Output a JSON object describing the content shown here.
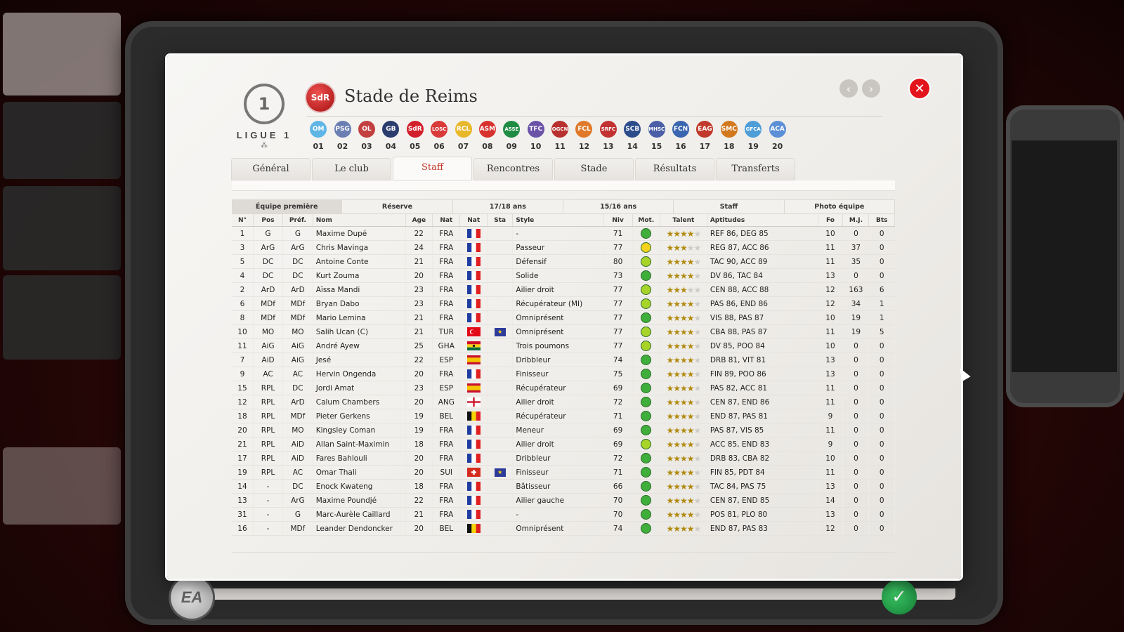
{
  "window": {
    "club_name": "Stade de Reims",
    "club_badge_text": "SdR"
  },
  "league": {
    "name": "LIGUE 1",
    "sub": "⁂"
  },
  "nav": {
    "prev": "‹",
    "next": "›",
    "close": "✕"
  },
  "clubs": [
    {
      "num": "01",
      "color": "#5fb6e6",
      "text": "OM"
    },
    {
      "num": "02",
      "color": "#6c7fb2",
      "text": "PSG"
    },
    {
      "num": "03",
      "color": "#c24040",
      "text": "OL"
    },
    {
      "num": "04",
      "color": "#2b3c6e",
      "text": "GB"
    },
    {
      "num": "05",
      "color": "#d21f2b",
      "text": "SdR"
    },
    {
      "num": "06",
      "color": "#d93a3a",
      "text": "LOSC"
    },
    {
      "num": "07",
      "color": "#e8b82a",
      "text": "RCL"
    },
    {
      "num": "08",
      "color": "#d8322f",
      "text": "ASM"
    },
    {
      "num": "09",
      "color": "#1f8c44",
      "text": "ASSE"
    },
    {
      "num": "10",
      "color": "#6b54a8",
      "text": "TFC"
    },
    {
      "num": "11",
      "color": "#b83030",
      "text": "OGCN"
    },
    {
      "num": "12",
      "color": "#e07a2a",
      "text": "FCL"
    },
    {
      "num": "13",
      "color": "#c23232",
      "text": "SRFC"
    },
    {
      "num": "14",
      "color": "#2c4c8c",
      "text": "SCB"
    },
    {
      "num": "15",
      "color": "#4b5fa8",
      "text": "MHSC"
    },
    {
      "num": "16",
      "color": "#3a66b0",
      "text": "FCN"
    },
    {
      "num": "17",
      "color": "#c0392b",
      "text": "EAG"
    },
    {
      "num": "18",
      "color": "#d2781e",
      "text": "SMC"
    },
    {
      "num": "19",
      "color": "#4f9ed8",
      "text": "GFCA"
    },
    {
      "num": "20",
      "color": "#5c8fd6",
      "text": "ACA"
    }
  ],
  "tabs": [
    {
      "label": "Général"
    },
    {
      "label": "Le club"
    },
    {
      "label": "Staff"
    },
    {
      "label": "Rencontres"
    },
    {
      "label": "Stade"
    },
    {
      "label": "Résultats"
    },
    {
      "label": "Transferts"
    }
  ],
  "active_tab": "Staff",
  "subtabs": [
    {
      "label": "Équipe première"
    },
    {
      "label": "Réserve"
    },
    {
      "label": "17/18 ans"
    },
    {
      "label": "15/16 ans"
    },
    {
      "label": "Staff"
    },
    {
      "label": "Photo équipe"
    }
  ],
  "columns": [
    "N°",
    "Pos",
    "Préf.",
    "Nom",
    "Age",
    "Nat",
    "Nat",
    "Sta",
    "Style",
    "Niv",
    "Mot.",
    "Talent",
    "Aptitudes",
    "Fo",
    "M.J.",
    "Bts"
  ],
  "players": [
    {
      "n": "1",
      "pos": "G",
      "pref": "G",
      "nom": "Maxime Dupé",
      "age": "22",
      "nat": "FRA",
      "flag": "fr",
      "sta": "",
      "style": "-",
      "niv": "71",
      "mot": "green",
      "talent": 4,
      "apt": "REF 86, DEG 85",
      "fo": "10",
      "mj": "0",
      "bts": "0"
    },
    {
      "n": "3",
      "pos": "ArG",
      "pref": "ArG",
      "nom": "Chris Mavinga",
      "age": "24",
      "nat": "FRA",
      "flag": "fr",
      "sta": "",
      "style": "Passeur",
      "niv": "77",
      "mot": "yellow",
      "talent": 3,
      "apt": "REG 87, ACC 86",
      "fo": "11",
      "mj": "37",
      "bts": "0"
    },
    {
      "n": "5",
      "pos": "DC",
      "pref": "DC",
      "nom": "Antoine Conte",
      "age": "21",
      "nat": "FRA",
      "flag": "fr",
      "sta": "",
      "style": "Défensif",
      "niv": "80",
      "mot": "lime",
      "talent": 4,
      "apt": "TAC 90, ACC 89",
      "fo": "11",
      "mj": "35",
      "bts": "0"
    },
    {
      "n": "4",
      "pos": "DC",
      "pref": "DC",
      "nom": "Kurt Zouma",
      "age": "20",
      "nat": "FRA",
      "flag": "fr",
      "sta": "",
      "style": "Solide",
      "niv": "73",
      "mot": "green",
      "talent": 4,
      "apt": "DV 86, TAC 84",
      "fo": "13",
      "mj": "0",
      "bts": "0"
    },
    {
      "n": "2",
      "pos": "ArD",
      "pref": "ArD",
      "nom": "Aïssa Mandi",
      "age": "23",
      "nat": "FRA",
      "flag": "fr",
      "sta": "",
      "style": "Ailier droit",
      "niv": "77",
      "mot": "lime",
      "talent": 3,
      "apt": "CEN 88, ACC 88",
      "fo": "12",
      "mj": "163",
      "bts": "6"
    },
    {
      "n": "6",
      "pos": "MDf",
      "pref": "MDf",
      "nom": "Bryan Dabo",
      "age": "23",
      "nat": "FRA",
      "flag": "fr",
      "sta": "",
      "style": "Récupérateur (MI)",
      "niv": "77",
      "mot": "lime",
      "talent": 4,
      "apt": "PAS 86, END 86",
      "fo": "12",
      "mj": "34",
      "bts": "1"
    },
    {
      "n": "8",
      "pos": "MDf",
      "pref": "MDf",
      "nom": "Mario Lemina",
      "age": "21",
      "nat": "FRA",
      "flag": "fr",
      "sta": "",
      "style": "Omniprésent",
      "niv": "77",
      "mot": "green",
      "talent": 4,
      "apt": "VIS 88, PAS 87",
      "fo": "10",
      "mj": "19",
      "bts": "1"
    },
    {
      "n": "10",
      "pos": "MO",
      "pref": "MO",
      "nom": "Salih Ucan (C)",
      "age": "21",
      "nat": "TUR",
      "flag": "tr",
      "sta": "eu",
      "style": "Omniprésent",
      "niv": "77",
      "mot": "lime",
      "talent": 4,
      "apt": "CBA 88, PAS 87",
      "fo": "11",
      "mj": "19",
      "bts": "5"
    },
    {
      "n": "11",
      "pos": "AiG",
      "pref": "AiG",
      "nom": "André Ayew",
      "age": "25",
      "nat": "GHA",
      "flag": "gh",
      "sta": "",
      "style": "Trois poumons",
      "niv": "77",
      "mot": "lime",
      "talent": 4,
      "apt": "DV 85, POO 84",
      "fo": "10",
      "mj": "0",
      "bts": "0"
    },
    {
      "n": "7",
      "pos": "AiD",
      "pref": "AiG",
      "nom": "Jesé",
      "age": "22",
      "nat": "ESP",
      "flag": "es",
      "sta": "",
      "style": "Dribbleur",
      "niv": "74",
      "mot": "green",
      "talent": 4,
      "apt": "DRB 81, VIT 81",
      "fo": "13",
      "mj": "0",
      "bts": "0"
    },
    {
      "n": "9",
      "pos": "AC",
      "pref": "AC",
      "nom": "Hervin Ongenda",
      "age": "20",
      "nat": "FRA",
      "flag": "fr",
      "sta": "",
      "style": "Finisseur",
      "niv": "75",
      "mot": "green",
      "talent": 4,
      "apt": "FIN 89, POO 86",
      "fo": "13",
      "mj": "0",
      "bts": "0"
    },
    {
      "n": "15",
      "pos": "RPL",
      "pref": "DC",
      "nom": "Jordi Amat",
      "age": "23",
      "nat": "ESP",
      "flag": "es",
      "sta": "",
      "style": "Récupérateur",
      "niv": "69",
      "mot": "green",
      "talent": 4,
      "apt": "PAS 82, ACC 81",
      "fo": "11",
      "mj": "0",
      "bts": "0"
    },
    {
      "n": "12",
      "pos": "RPL",
      "pref": "ArD",
      "nom": "Calum Chambers",
      "age": "20",
      "nat": "ANG",
      "flag": "en",
      "sta": "",
      "style": "Ailier droit",
      "niv": "72",
      "mot": "green",
      "talent": 4,
      "apt": "CEN 87, END 86",
      "fo": "11",
      "mj": "0",
      "bts": "0"
    },
    {
      "n": "18",
      "pos": "RPL",
      "pref": "MDf",
      "nom": "Pieter Gerkens",
      "age": "19",
      "nat": "BEL",
      "flag": "be",
      "sta": "",
      "style": "Récupérateur",
      "niv": "71",
      "mot": "green",
      "talent": 4,
      "apt": "END 87, PAS 81",
      "fo": "9",
      "mj": "0",
      "bts": "0"
    },
    {
      "n": "20",
      "pos": "RPL",
      "pref": "MO",
      "nom": "Kingsley Coman",
      "age": "19",
      "nat": "FRA",
      "flag": "fr",
      "sta": "",
      "style": "Meneur",
      "niv": "69",
      "mot": "green",
      "talent": 4,
      "apt": "PAS 87, VIS 85",
      "fo": "11",
      "mj": "0",
      "bts": "0"
    },
    {
      "n": "21",
      "pos": "RPL",
      "pref": "AiD",
      "nom": "Allan Saint-Maximin",
      "age": "18",
      "nat": "FRA",
      "flag": "fr",
      "sta": "",
      "style": "Ailier droit",
      "niv": "69",
      "mot": "lime",
      "talent": 4,
      "apt": "ACC 85, END 83",
      "fo": "9",
      "mj": "0",
      "bts": "0"
    },
    {
      "n": "17",
      "pos": "RPL",
      "pref": "AiD",
      "nom": "Fares Bahlouli",
      "age": "20",
      "nat": "FRA",
      "flag": "fr",
      "sta": "",
      "style": "Dribbleur",
      "niv": "72",
      "mot": "green",
      "talent": 4,
      "apt": "DRB 83, CBA 82",
      "fo": "10",
      "mj": "0",
      "bts": "0"
    },
    {
      "n": "19",
      "pos": "RPL",
      "pref": "AC",
      "nom": "Omar Thali",
      "age": "20",
      "nat": "SUI",
      "flag": "ch",
      "sta": "eu",
      "style": "Finisseur",
      "niv": "71",
      "mot": "green",
      "talent": 4,
      "apt": "FIN 85, PDT 84",
      "fo": "11",
      "mj": "0",
      "bts": "0"
    },
    {
      "n": "14",
      "pos": "-",
      "pref": "DC",
      "nom": "Enock Kwateng",
      "age": "18",
      "nat": "FRA",
      "flag": "fr",
      "sta": "",
      "style": "Bâtisseur",
      "niv": "66",
      "mot": "green",
      "talent": 4,
      "apt": "TAC 84, PAS 75",
      "fo": "13",
      "mj": "0",
      "bts": "0"
    },
    {
      "n": "13",
      "pos": "-",
      "pref": "ArG",
      "nom": "Maxime Poundjé",
      "age": "22",
      "nat": "FRA",
      "flag": "fr",
      "sta": "",
      "style": "Ailier gauche",
      "niv": "70",
      "mot": "green",
      "talent": 4,
      "apt": "CEN 87, END 85",
      "fo": "14",
      "mj": "0",
      "bts": "0"
    },
    {
      "n": "31",
      "pos": "-",
      "pref": "G",
      "nom": "Marc-Aurèle Caillard",
      "age": "21",
      "nat": "FRA",
      "flag": "fr",
      "sta": "",
      "style": "-",
      "niv": "70",
      "mot": "green",
      "talent": 4,
      "apt": "POS 81, PLO 80",
      "fo": "13",
      "mj": "0",
      "bts": "0"
    },
    {
      "n": "16",
      "pos": "-",
      "pref": "MDf",
      "nom": "Leander Dendoncker",
      "age": "20",
      "nat": "BEL",
      "flag": "be",
      "sta": "",
      "style": "Omniprésent",
      "niv": "74",
      "mot": "green",
      "talent": 4,
      "apt": "END 87, PAS 83",
      "fo": "12",
      "mj": "0",
      "bts": "0"
    }
  ],
  "colors": {
    "accent_red": "#e3141c",
    "active_tab_text": "#c43a2a",
    "mot_green": "#3fae3a",
    "mot_lime": "#a8d42a",
    "mot_yellow": "#f2d21c"
  },
  "background": {
    "ea_logo": "EA",
    "confirm": "✓"
  }
}
